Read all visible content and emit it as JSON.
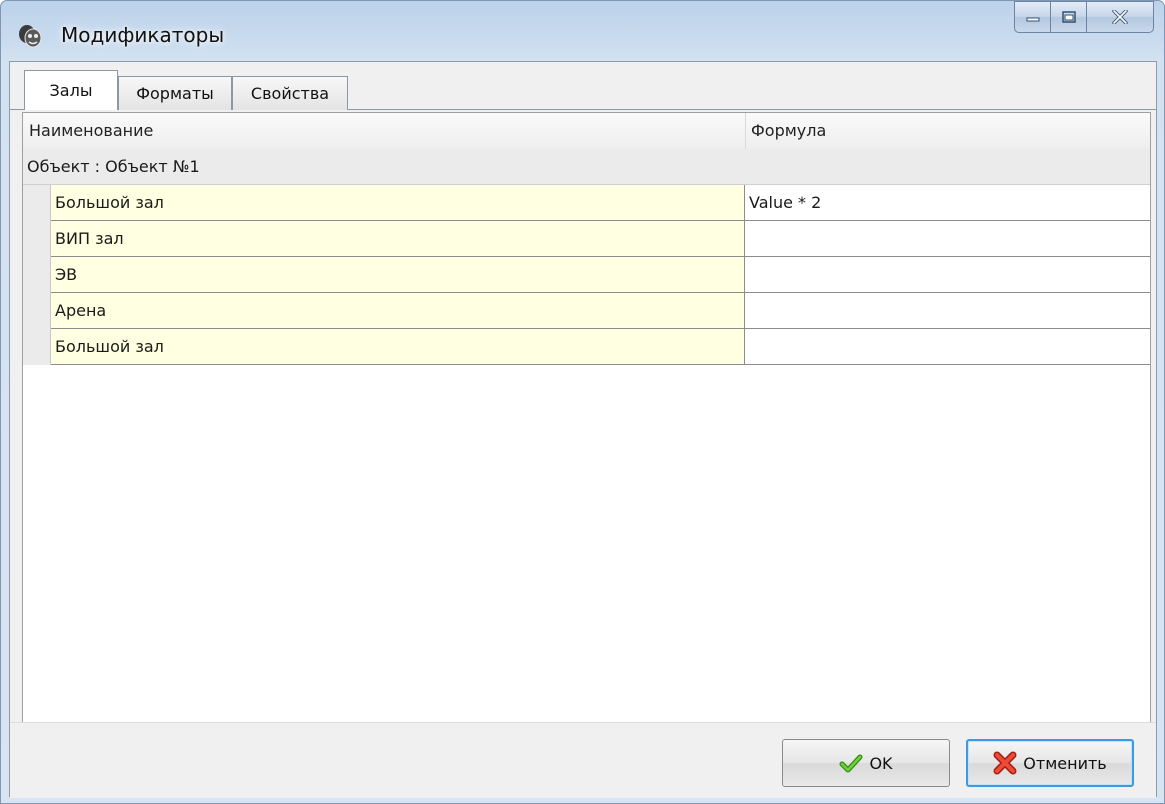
{
  "window": {
    "title": "Модификаторы",
    "icon": "theater-masks-icon",
    "controls": {
      "minimize": "minimize-icon",
      "maximize": "maximize-icon",
      "close": "close-icon"
    }
  },
  "tabs": [
    {
      "label": "Залы",
      "active": true
    },
    {
      "label": "Форматы",
      "active": false
    },
    {
      "label": "Свойства",
      "active": false
    }
  ],
  "grid": {
    "columns": [
      "Наименование",
      "Формула"
    ],
    "group_label": "Объект : Объект №1",
    "rows": [
      {
        "name": "Большой зал",
        "formula": "Value * 2"
      },
      {
        "name": "ВИП зал",
        "formula": ""
      },
      {
        "name": "ЭВ",
        "formula": ""
      },
      {
        "name": "Арена",
        "formula": ""
      },
      {
        "name": "Большой зал",
        "formula": ""
      }
    ]
  },
  "buttons": {
    "ok_label": "OK",
    "ok_icon": "checkmark-icon",
    "cancel_label": "Отменить",
    "cancel_icon": "red-x-icon"
  },
  "colors": {
    "name_cell_bg": "#ffffe1",
    "checkmark": "#4caf1e",
    "cancel_x": "#e03b2b",
    "cancel_focus_border": "#3c9be0"
  }
}
